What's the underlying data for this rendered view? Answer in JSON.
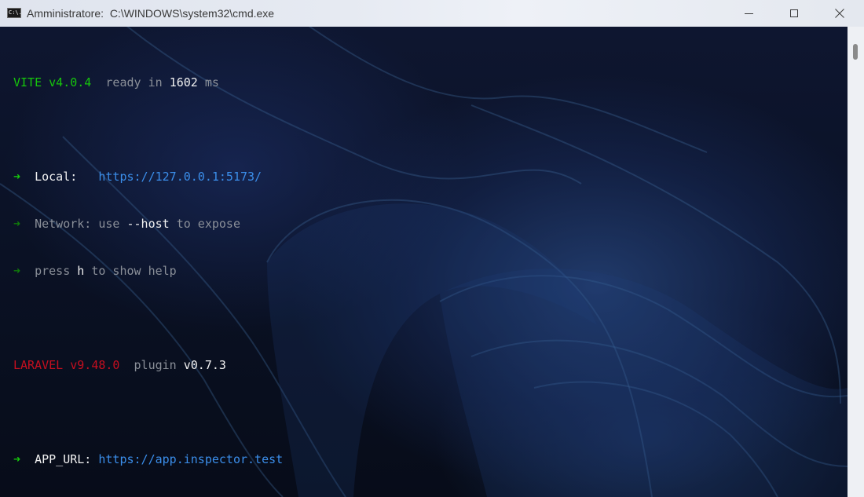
{
  "window": {
    "title_prefix": "Amministratore:",
    "title_path": "C:\\WINDOWS\\system32\\cmd.exe",
    "icon_name": "cmd-icon",
    "icon_text": "C:\\."
  },
  "controls": {
    "minimize_icon": "minimize-icon",
    "maximize_icon": "maximize-icon",
    "close_icon": "close-icon"
  },
  "console": {
    "vite": {
      "name": "VITE",
      "version": "v4.0.4",
      "ready_text": "ready in",
      "ready_ms": "1602",
      "ms_unit": "ms"
    },
    "local": {
      "arrow": "➜",
      "label": "Local:",
      "url": "https://127.0.0.1:5173/"
    },
    "network": {
      "arrow": "➜",
      "label": "Network:",
      "use": "use",
      "flag": "--host",
      "rest": "to expose"
    },
    "help": {
      "arrow": "➜",
      "press": "press",
      "key": "h",
      "rest": "to show help"
    },
    "laravel": {
      "name": "LARAVEL",
      "version": "v9.48.0",
      "plugin_label": "plugin",
      "plugin_version": "v0.7.3"
    },
    "app_url": {
      "arrow": "➜",
      "label": "APP_URL:",
      "url": "https://app.inspector.test"
    }
  },
  "colors": {
    "green": "#16c60c",
    "link": "#3b8eea",
    "red": "#c50f1f",
    "dim": "#8a8f98",
    "bright": "#f2f2f2"
  }
}
